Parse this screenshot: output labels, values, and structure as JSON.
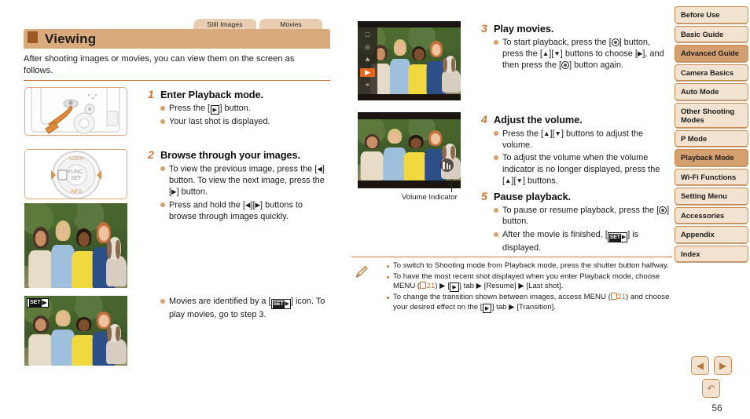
{
  "header": {
    "tabs": [
      "Still Images",
      "Movies"
    ],
    "title": "Viewing",
    "intro": "After shooting images or movies, you can view them on the screen as follows."
  },
  "steps": [
    {
      "num": "1",
      "title": "Enter Playback mode.",
      "bullets": [
        {
          "pre": "Press the [",
          "key": "play-icon",
          "post": "] button."
        },
        {
          "pre": "Your last shot is displayed.",
          "key": "",
          "post": ""
        }
      ]
    },
    {
      "num": "2",
      "title": "Browse through your images.",
      "bullets": [
        {
          "pre": "To view the previous image, press the [◀] button. To view the next image, press the [▶] button.",
          "key": "",
          "post": ""
        },
        {
          "pre": "Press and hold the [◀][▶] buttons to browse through images quickly.",
          "key": "",
          "post": ""
        }
      ]
    },
    {
      "num": "3",
      "title": "Play movies.",
      "bullets": [
        {
          "pre": "To start playback, press the [func] button, press the [▲][▼] buttons to choose [▶], and then press the [func] button again.",
          "key": "",
          "post": ""
        }
      ]
    },
    {
      "num": "4",
      "title": "Adjust the volume.",
      "bullets": [
        {
          "pre": "Press the [▲][▼] buttons to adjust the volume.",
          "key": "",
          "post": ""
        },
        {
          "pre": "To adjust the volume when the volume indicator is no longer displayed, press the [▲][▼] buttons.",
          "key": "",
          "post": ""
        }
      ]
    },
    {
      "num": "5",
      "title": "Pause playback.",
      "bullets": [
        {
          "pre": "To pause or resume playback, press the [func] button.",
          "key": "",
          "post": ""
        },
        {
          "pre": "After the movie is finished, [SET ▶] is displayed.",
          "key": "",
          "post": ""
        }
      ]
    }
  ],
  "movie_note": "Movies are identified by a [SET ▶] icon. To play movies, go to step 3.",
  "captions": {
    "volume_indicator": "Volume Indicator"
  },
  "badges": {
    "set_label": "SET",
    "play_glyph": "▶"
  },
  "notes": {
    "icon": "pencil-icon",
    "items": [
      "To switch to Shooting mode from Playback mode, press the shutter button halfway.",
      "To have the most recent shot displayed when you enter Playback mode, choose MENU (21) ▶ [play] tab ▶ [Resume] ▶ [Last shot].",
      "To change the transition shown between images, access MENU (21) and choose your desired effect on the [play] tab ▶ [Transition]."
    ],
    "page_ref": "21",
    "menu_label": "MENU",
    "resume_label": "[Resume]",
    "last_shot_label": "[Last shot]",
    "transition_label": "[Transition]",
    "tab_word": "tab"
  },
  "sidebar": {
    "items": [
      {
        "label": "Before Use",
        "active": false
      },
      {
        "label": "Basic Guide",
        "active": false
      },
      {
        "label": "Advanced Guide",
        "active": true
      },
      {
        "label": "Camera Basics",
        "active": false
      },
      {
        "label": "Auto Mode",
        "active": false
      },
      {
        "label": "Other Shooting Modes",
        "active": false
      },
      {
        "label": "P Mode",
        "active": false
      },
      {
        "label": "Playback Mode",
        "active": true
      },
      {
        "label": "Wi-Fi Functions",
        "active": false
      },
      {
        "label": "Setting Menu",
        "active": false
      },
      {
        "label": "Accessories",
        "active": false
      },
      {
        "label": "Appendix",
        "active": false
      },
      {
        "label": "Index",
        "active": false
      }
    ]
  },
  "pager": {
    "prev_icon": "◀",
    "next_icon": "▶",
    "back_icon": "↶",
    "page_number": "56"
  },
  "colors": {
    "accent_orange": "#c8763a",
    "title_bar": "#d9ab7c",
    "tab": "#e8cdb0",
    "nav_active": "#d4a070",
    "nav_bg": "#f2e2d0",
    "highlight_orange": "#e8661a"
  }
}
